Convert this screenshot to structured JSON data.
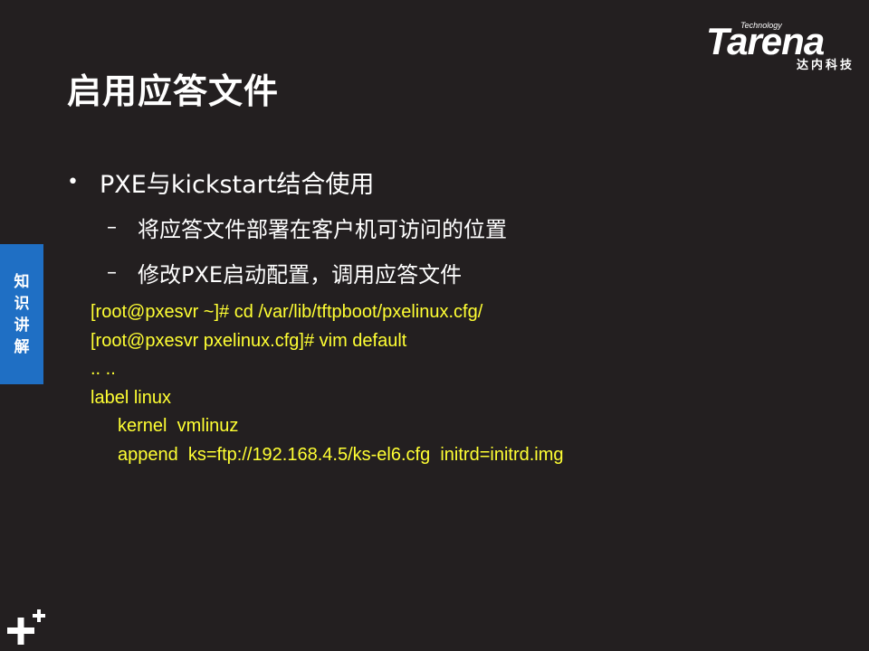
{
  "slide": {
    "title": "启用应答文件",
    "side_tab": "知识讲解",
    "logo": {
      "tech": "Technology",
      "word": "Tarena",
      "cn": "达内科技"
    },
    "bullets": [
      {
        "text": "PXE与kickstart结合使用",
        "sub": [
          "将应答文件部署在客户机可访问的位置",
          "修改PXE启动配置，调用应答文件"
        ]
      }
    ],
    "bullet_dot": "•",
    "bullet_dash": "–",
    "code_lines": [
      "[root@pxesvr ~]# cd /var/lib/tftpboot/pxelinux.cfg/",
      "[root@pxesvr pxelinux.cfg]# vim default",
      ".. ..",
      "label linux",
      "kernel  vmlinuz",
      "append  ks=ftp://192.168.4.5/ks-el6.cfg  initrd=initrd.img"
    ],
    "colors": {
      "background": "#231f20",
      "code": "#ffff33",
      "side_tab": "#1f6fc4"
    },
    "icons": [
      "plus-plus-icon"
    ]
  }
}
